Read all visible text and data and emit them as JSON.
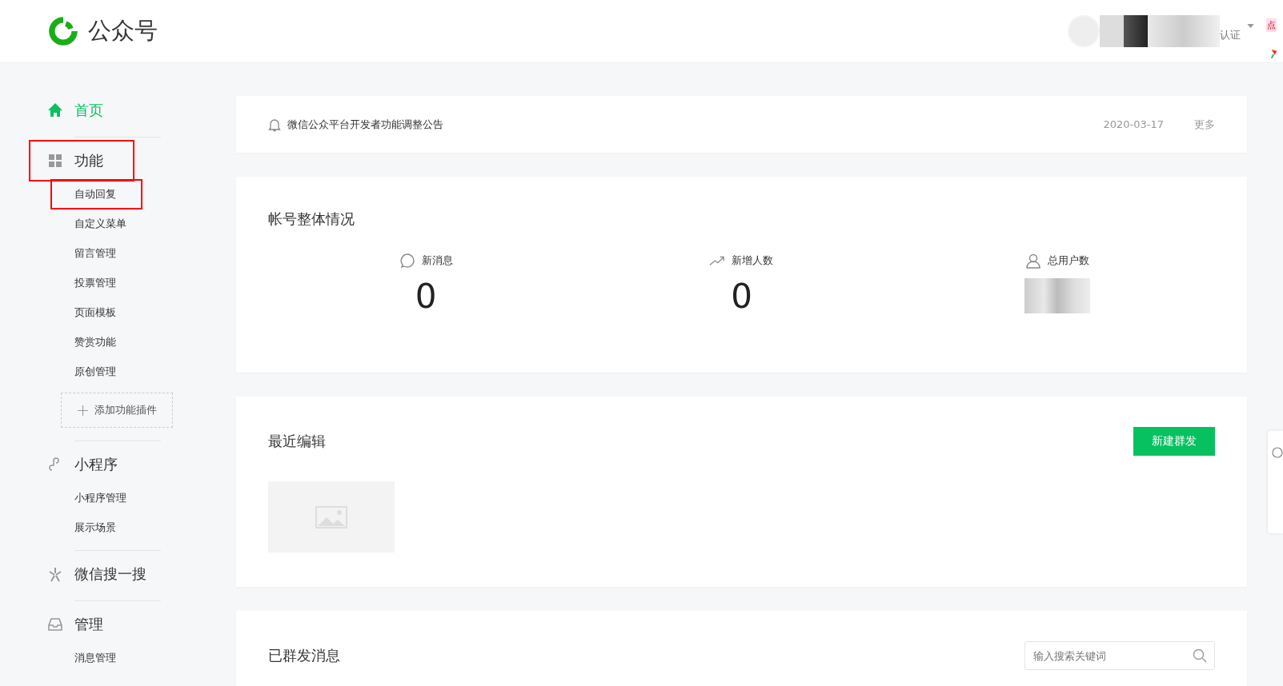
{
  "header": {
    "brand": "公众号",
    "account_badge": "认证",
    "sticker": "点"
  },
  "sidebar": [
    {
      "kind": "home",
      "title": "首页",
      "selected": true,
      "highlighted": false
    },
    {
      "kind": "grid",
      "title": "功能",
      "selected": false,
      "highlighted": true,
      "items": [
        {
          "label": "自动回复",
          "highlighted": true
        },
        {
          "label": "自定义菜单",
          "highlighted": false
        },
        {
          "label": "留言管理",
          "highlighted": false
        },
        {
          "label": "投票管理",
          "highlighted": false
        },
        {
          "label": "页面模板",
          "highlighted": false
        },
        {
          "label": "赞赏功能",
          "highlighted": false
        },
        {
          "label": "原创管理",
          "highlighted": false
        }
      ],
      "add_button": "添加功能插件"
    },
    {
      "kind": "link",
      "title": "小程序",
      "selected": false,
      "highlighted": false,
      "items": [
        {
          "label": "小程序管理",
          "highlighted": false
        },
        {
          "label": "展示场景",
          "highlighted": false
        }
      ]
    },
    {
      "kind": "spark",
      "title": "微信搜一搜",
      "selected": false,
      "highlighted": false
    },
    {
      "kind": "inbox",
      "title": "管理",
      "selected": false,
      "highlighted": false,
      "items": [
        {
          "label": "消息管理",
          "highlighted": false
        }
      ]
    }
  ],
  "notice": {
    "text": "微信公众平台开发者功能调整公告",
    "date": "2020-03-17",
    "more": "更多"
  },
  "overview": {
    "title": "帐号整体情况",
    "stats": [
      {
        "kind": "message",
        "label": "新消息",
        "value": "0"
      },
      {
        "kind": "trend",
        "label": "新增人数",
        "value": "0"
      },
      {
        "kind": "user",
        "label": "总用户数"
      }
    ]
  },
  "recent": {
    "title": "最近编辑",
    "button": "新建群发"
  },
  "sent": {
    "title": "已群发消息",
    "search": {
      "placeholder": "输入搜索关键词"
    }
  }
}
